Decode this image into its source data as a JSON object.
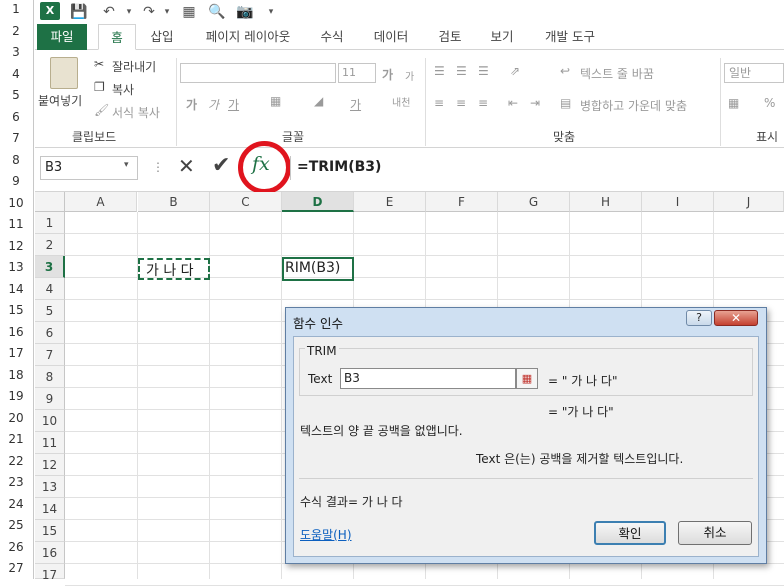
{
  "line_numbers": [
    "1",
    "2",
    "3",
    "4",
    "5",
    "6",
    "7",
    "8",
    "9",
    "10",
    "11",
    "12",
    "13",
    "14",
    "15",
    "16",
    "17",
    "18",
    "19",
    "20",
    "21",
    "22",
    "23",
    "24",
    "25",
    "26",
    "27"
  ],
  "tabs": [
    "파일",
    "홈",
    "삽입",
    "페이지 레이아웃",
    "수식",
    "데이터",
    "검토",
    "보기",
    "개발 도구"
  ],
  "ribbon": {
    "clipboard": {
      "paste": "붙여넣기",
      "cut": "잘라내기",
      "copy": "복사",
      "format_painter": "서식 복사",
      "label": "클립보드"
    },
    "font": {
      "size": "11",
      "label": "글꼴"
    },
    "alignment": {
      "wrap_text": "텍스트 줄 바꿈",
      "merge_center": "병합하고 가운데 맞춤",
      "label": "맞춤"
    },
    "number": {
      "format": "일반",
      "label": "표시"
    }
  },
  "formula_bar": {
    "name_box": "B3",
    "formula": "=TRIM(B3)"
  },
  "grid": {
    "columns": [
      "A",
      "B",
      "C",
      "D",
      "E",
      "F",
      "G",
      "H",
      "I",
      "J"
    ],
    "rows": [
      "1",
      "2",
      "3",
      "4",
      "5",
      "6",
      "7",
      "8",
      "9",
      "10",
      "11",
      "12",
      "13",
      "14",
      "15",
      "16",
      "17"
    ],
    "cell_b3": "가 나 다",
    "cell_d3": "RIM(B3)"
  },
  "dialog": {
    "title": "함수 인수",
    "function_name": "TRIM",
    "arg_label": "Text",
    "arg_value": "B3",
    "arg_result": "=  \" 가 나 다\"",
    "result_preview": "=  \"가 나 다\"",
    "description": "텍스트의 양 끝 공백을 없앱니다.",
    "arg_description": "Text  은(는) 공백을 제거할 텍스트입니다.",
    "formula_result": "수식 결과=  가 나 다",
    "help_link": "도움말(H)",
    "ok": "확인",
    "cancel": "취소"
  }
}
